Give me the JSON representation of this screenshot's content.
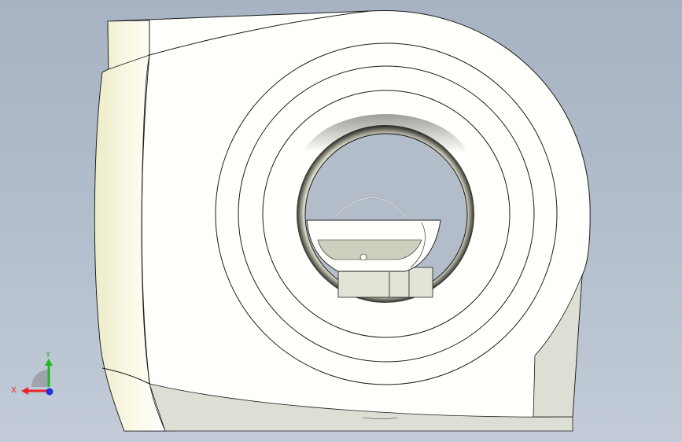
{
  "triad": {
    "x_label": "X",
    "y_label": "Y",
    "colors": {
      "x": "#e8252b",
      "y": "#1fb81f",
      "z": "#2033d8"
    }
  },
  "colors": {
    "background_top": "#a7b3c3",
    "background_bottom": "#c3ccd8",
    "body": "#fffffb",
    "shadow_face": "#dedfd4",
    "edge": "#1a1a1a"
  }
}
